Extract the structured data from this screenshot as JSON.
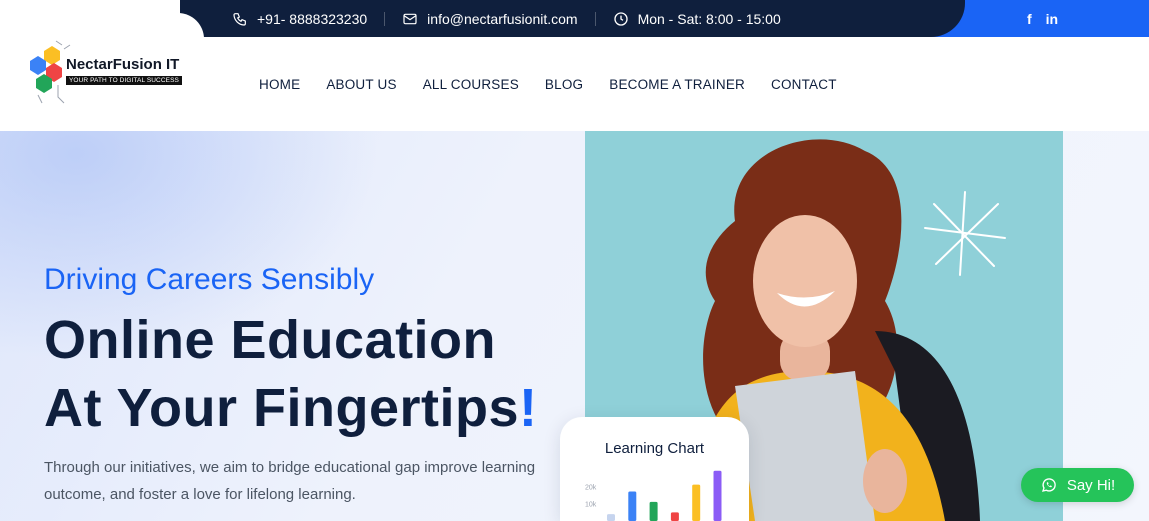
{
  "topbar": {
    "phone": "+91- 8888323230",
    "email": "info@nectarfusionit.com",
    "hours": "Mon - Sat: 8:00 - 15:00",
    "social": [
      "f",
      "in"
    ]
  },
  "logo": {
    "name": "NectarFusion IT",
    "tagline": "YOUR PATH TO DIGITAL SUCCESS"
  },
  "nav": {
    "items": [
      "HOME",
      "ABOUT US",
      "ALL COURSES",
      "BLOG",
      "BECOME A TRAINER",
      "CONTACT"
    ]
  },
  "hero": {
    "tagline": "Driving Careers Sensibly",
    "headline_line1": "Online Education",
    "headline_line2": "At Your Fingertips",
    "headline_mark": "!",
    "lead": "Through our initiatives, we aim to bridge educational gap improve learning outcome, and foster a love for lifelong learning."
  },
  "chart_card": {
    "title": "Learning Chart"
  },
  "chart_data": {
    "type": "bar",
    "title": "Learning Chart",
    "yticks": [
      "20k",
      "10k"
    ],
    "ylim": [
      0,
      30000
    ],
    "values": [
      4000,
      17000,
      11000,
      5000,
      21000,
      29000
    ],
    "colors": [
      "#c6d4ee",
      "#3b82f6",
      "#22a559",
      "#ef4444",
      "#fbbf24",
      "#8b5cf6"
    ]
  },
  "whatsapp": {
    "label": "Say Hi!"
  },
  "colors": {
    "navy": "#0f1f3d",
    "accent_blue": "#1a64f5",
    "whatsapp_green": "#25c45a"
  }
}
